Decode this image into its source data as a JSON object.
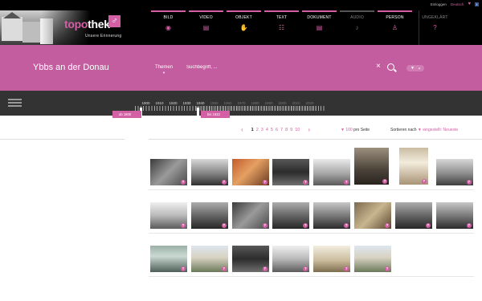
{
  "header": {
    "logo_part1": "topo",
    "logo_part2": "thek",
    "logo_mark": "♂",
    "tagline": "Unsere Erinnerung",
    "util": {
      "login": "Einloggen",
      "lang": "Deutsch"
    },
    "categories": [
      {
        "label": "BILD",
        "icon": "camera-icon",
        "glyph": "◉"
      },
      {
        "label": "VIDEO",
        "icon": "film-icon",
        "glyph": "▤"
      },
      {
        "label": "OBJEKT",
        "icon": "hand-icon",
        "glyph": "✋"
      },
      {
        "label": "TEXT",
        "icon": "text-icon",
        "glyph": "☷"
      },
      {
        "label": "DOKUMENT",
        "icon": "document-icon",
        "glyph": "▤"
      },
      {
        "label": "AUDIO",
        "icon": "audio-icon",
        "glyph": "♪"
      },
      {
        "label": "PERSON",
        "icon": "person-icon",
        "glyph": "♙"
      },
      {
        "label": "UNGEKLÄRT",
        "icon": "question-icon",
        "glyph": "?"
      }
    ],
    "accent": "#d35fa4"
  },
  "search": {
    "place": "Ybbs an der Donau",
    "themes": "Themen",
    "placeholder": "Suchbegriff, ...",
    "filter_badge": "▼",
    "band_color": "#c45d9f"
  },
  "timeline": {
    "years": [
      "1900",
      "1910",
      "1920",
      "1930",
      "1940",
      "1950",
      "1960",
      "1970",
      "1980",
      "1990",
      "2000",
      "2010",
      "2020"
    ],
    "from_label": "ab 1900",
    "to_label": "bis 1933"
  },
  "pagination": {
    "pages": [
      "1",
      "2",
      "3",
      "4",
      "5",
      "6",
      "7",
      "8",
      "9",
      "10"
    ],
    "current": "1",
    "per_page_num": "100",
    "per_page_label": "pro Seite",
    "sort_label": "Sortieren nach",
    "sort_value": "eingestellt: Neueste"
  },
  "thumbnails": [
    {
      "style": "t-a"
    },
    {
      "style": "t-b"
    },
    {
      "style": "t-c"
    },
    {
      "style": "t-d"
    },
    {
      "style": "t-e"
    },
    {
      "style": "t-f"
    },
    {
      "style": "t-g"
    },
    {
      "style": "t-h"
    },
    {
      "style": "t-i"
    },
    {
      "style": "t-j"
    },
    {
      "style": "t-a"
    },
    {
      "style": "t-j"
    },
    {
      "style": "t-m"
    },
    {
      "style": "t-k"
    },
    {
      "style": "t-j"
    },
    {
      "style": "t-m"
    },
    {
      "style": "t-l"
    },
    {
      "style": "t-o"
    },
    {
      "style": "t-d"
    },
    {
      "style": "t-i"
    },
    {
      "style": "t-n"
    },
    {
      "style": "t-o"
    }
  ]
}
